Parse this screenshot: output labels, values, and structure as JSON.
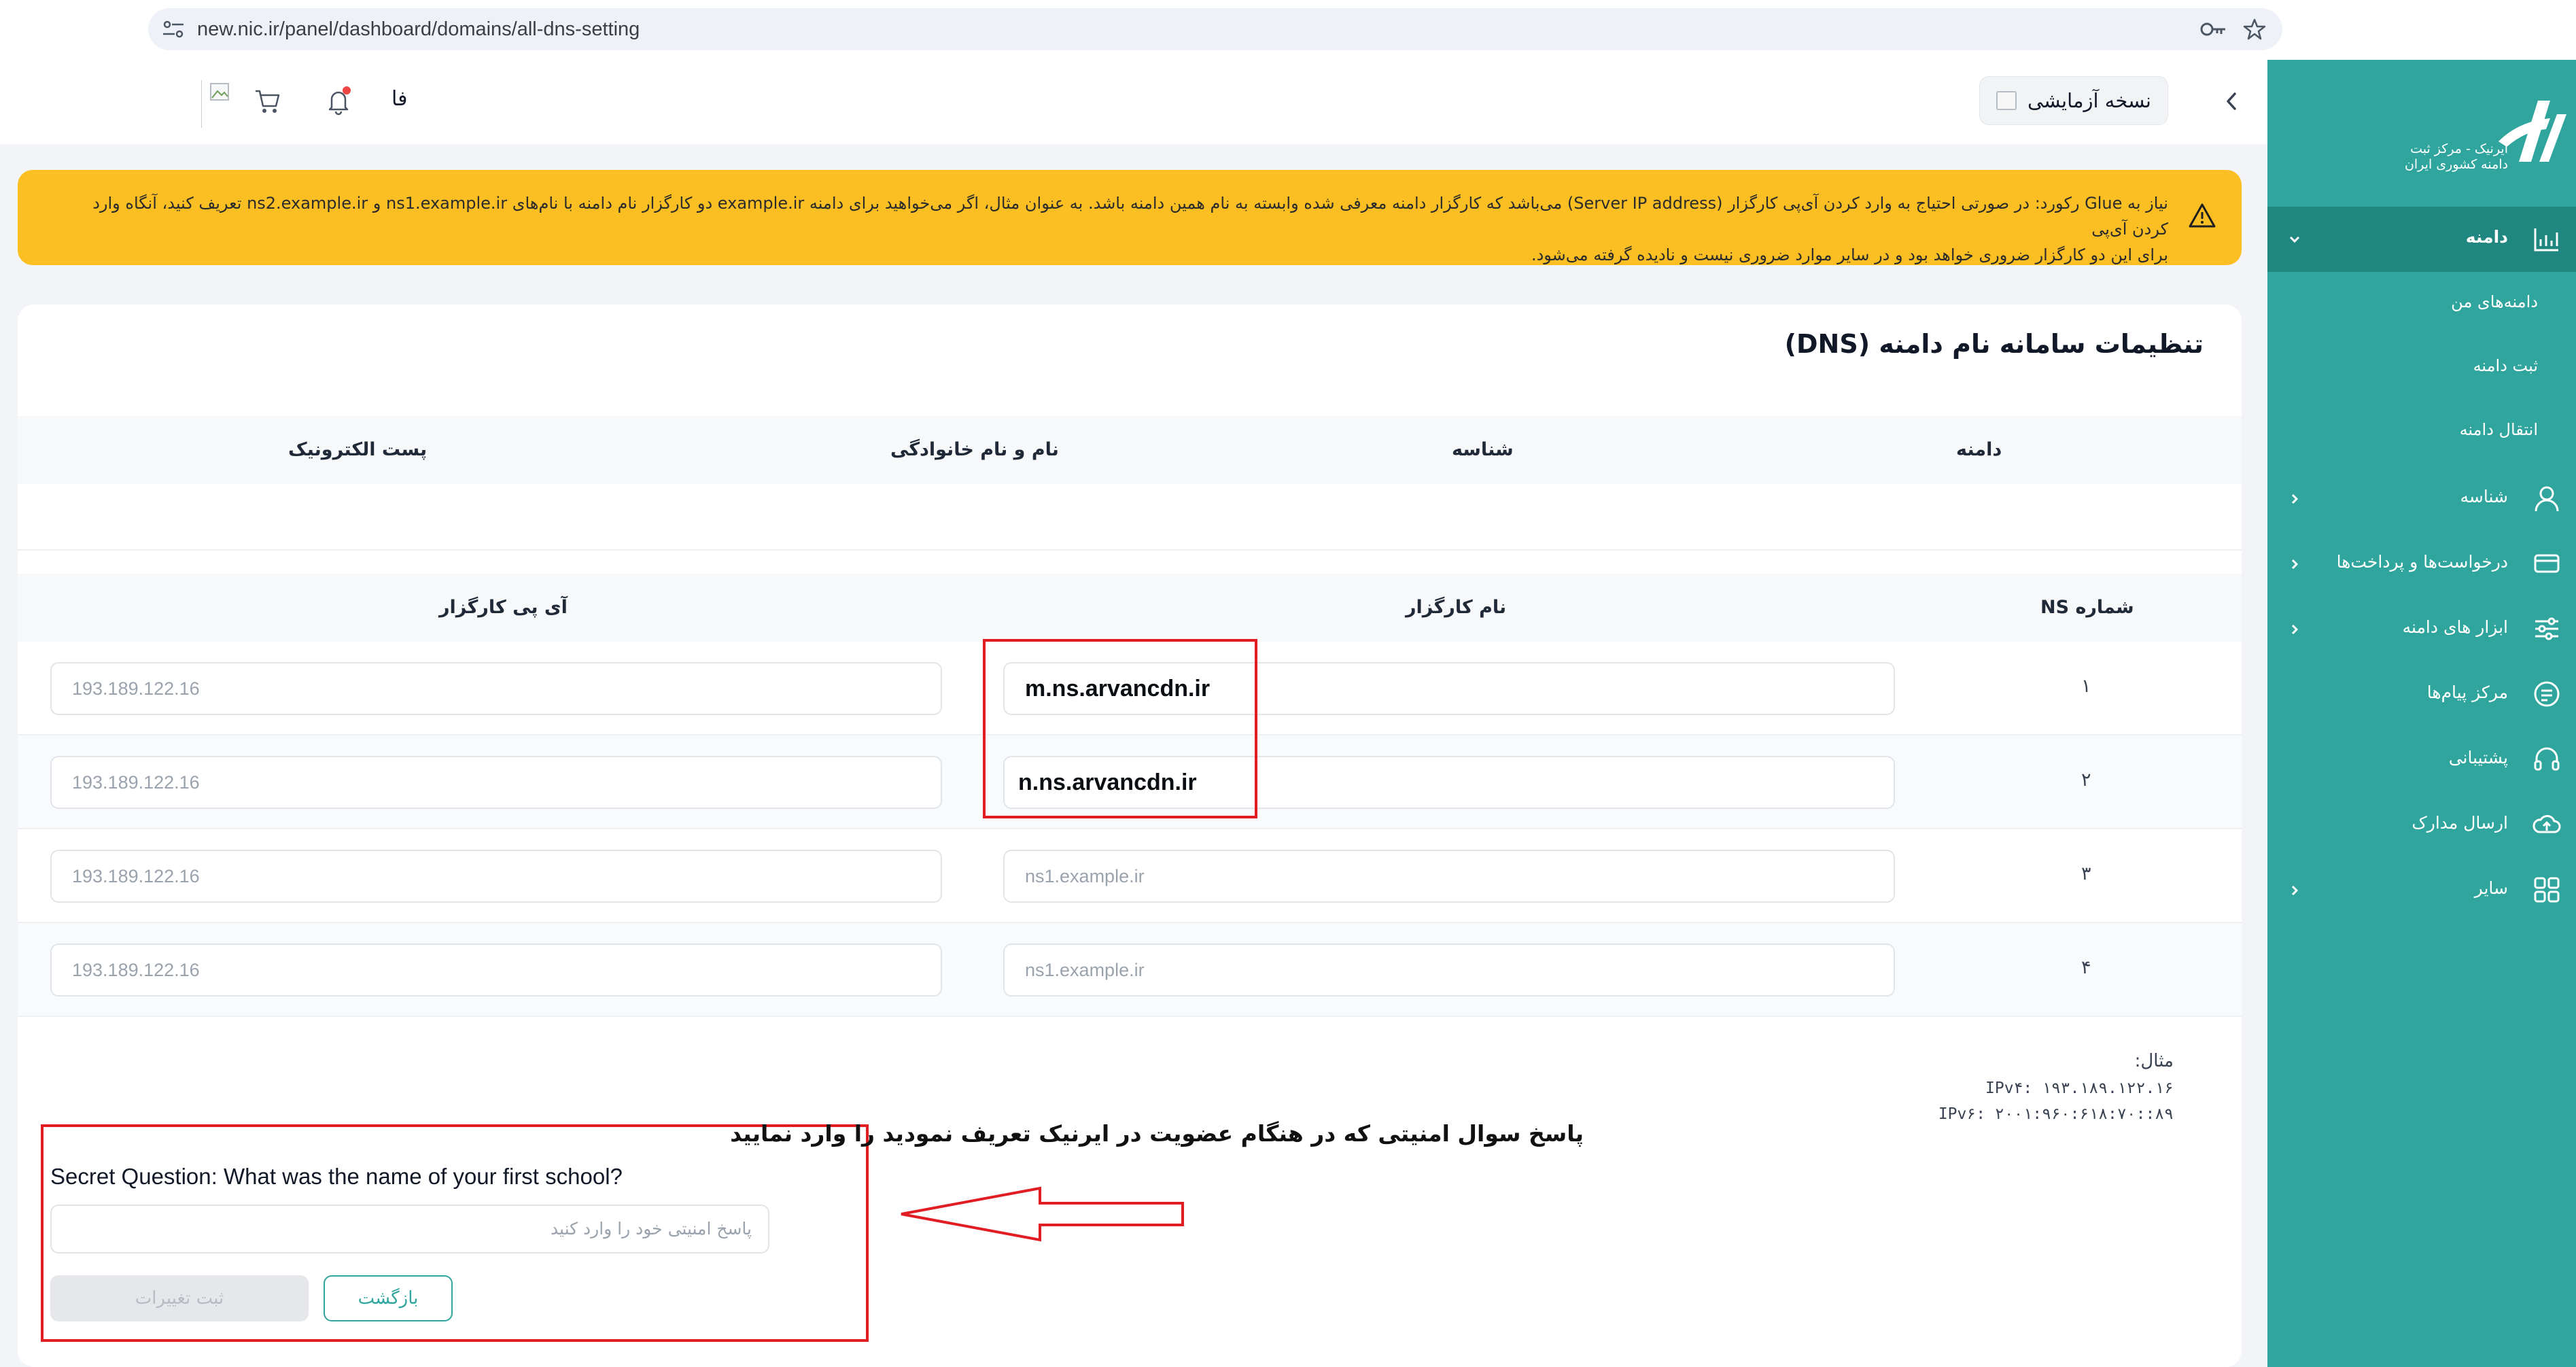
{
  "browser": {
    "url": "new.nic.ir/panel/dashboard/domains/all-dns-setting"
  },
  "sidebar": {
    "logo_text_line1": "ایرنیک - مرکز ثبت",
    "logo_text_line2": "دامنه کشوری ایران",
    "items": [
      {
        "label": "دامنه",
        "icon": "chart-icon"
      },
      {
        "label": "شناسه",
        "icon": "user-icon"
      },
      {
        "label": "درخواست‌ها و پرداخت‌ها",
        "icon": "card-icon"
      },
      {
        "label": "ابزار های دامنه",
        "icon": "sliders-icon"
      },
      {
        "label": "مرکز پیام‌ها",
        "icon": "message-icon"
      },
      {
        "label": "پشتیبانی",
        "icon": "headset-icon"
      },
      {
        "label": "ارسال مدارک",
        "icon": "upload-icon"
      },
      {
        "label": "سایر",
        "icon": "grid-icon"
      }
    ],
    "sub_items": [
      "دامنه‌های من",
      "ثبت دامنه",
      "انتقال دامنه"
    ]
  },
  "header": {
    "lang": "فا",
    "trial_label": "نسخه آزمایشی"
  },
  "warning": {
    "line1": "نیاز به Glue رکورد: در صورتی احتیاج به وارد کردن آی‌پی کارگزار (Server IP address) می‌باشد که کارگزار دامنه معرفی شده وابسته به نام همین دامنه باشد. به عنوان مثال، اگر می‌خواهید برای دامنه example.ir دو کارگزار نام دامنه با نام‌های ns1.example.ir و ns2.example.ir تعریف کنید، آنگاه وارد کردن آی‌پی",
    "line2": "برای این دو کارگزار ضروری خواهد بود و در سایر موارد ضروری نیست و نادیده گرفته می‌شود."
  },
  "main": {
    "title": "تنظیمات سامانه نام دامنه (DNS)",
    "table1_headers": [
      "دامنه",
      "شناسه",
      "نام و نام خانوادگی",
      "پست الکترونیک"
    ],
    "table2_headers": [
      "شماره NS",
      "نام کارگزار",
      "آی پی کارگزار"
    ],
    "ns_rows": [
      {
        "num": "۱",
        "name": "m.ns.arvancdn.ir",
        "ip_placeholder": "193.189.122.16"
      },
      {
        "num": "۲",
        "name": "n.ns.arvancdn.ir",
        "ip_placeholder": "193.189.122.16"
      },
      {
        "num": "۳",
        "name_placeholder": "ns1.example.ir",
        "ip_placeholder": "193.189.122.16"
      },
      {
        "num": "۴",
        "name_placeholder": "ns1.example.ir",
        "ip_placeholder": "193.189.122.16"
      }
    ],
    "example_label": "مثال:",
    "example_ipv4": "IPv۴: ۱۹۳.۱۸۹.۱۲۲.۱۶",
    "example_ipv6": "IPv۶: ۲۰۰۱:۹۶۰:۶۱۸:۷۰::۸۹",
    "secret_question": "Secret Question: What was the name of your first school?",
    "answer_placeholder": "پاسخ امنیتی خود را وارد کنید",
    "submit_label": "ثبت تغییرات",
    "back_label": "بازگشت"
  },
  "annotation": {
    "text": "پاسخ سوال امنیتی که  در هنگام عضویت در ایرنیک تعریف نمودید را وارد نمایید"
  },
  "colors": {
    "sidebar": "#2fa59d",
    "sidebar_active": "#1f8780",
    "warning": "#fbbf24",
    "annotation_red": "#e11d24"
  }
}
